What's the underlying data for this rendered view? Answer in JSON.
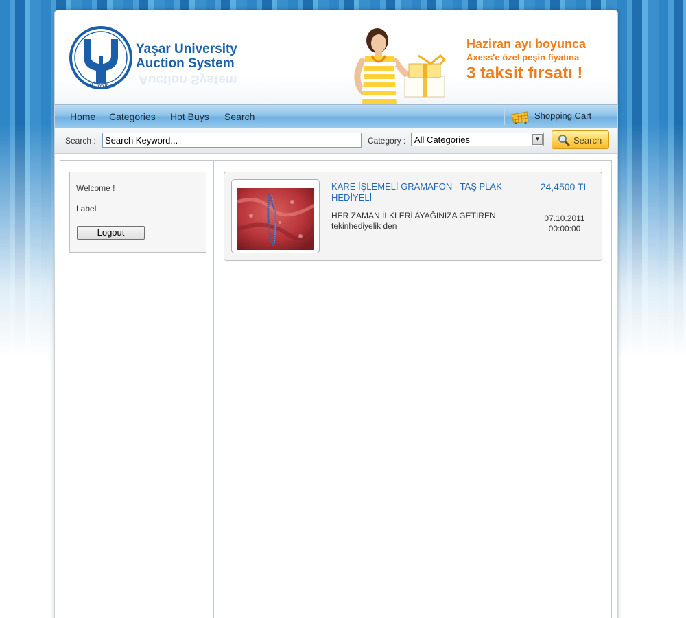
{
  "logo": {
    "line1": "Yaşar University",
    "line2": "Auction System",
    "year_prefix": "10",
    "year_sup": "th",
    "year_suffix": " year"
  },
  "promo": {
    "line1": "Haziran ayı boyunca",
    "line2": "Axess'e özel peşin fiyatına",
    "line3": "3 taksit fırsatı !"
  },
  "nav": {
    "items": [
      {
        "label": "Home"
      },
      {
        "label": "Categories"
      },
      {
        "label": "Hot Buys"
      },
      {
        "label": "Search"
      }
    ],
    "cart_label": "Shopping Cart"
  },
  "search": {
    "label": "Search :",
    "value": "Search Keyword...",
    "category_label": "Category :",
    "category_selected": "All Categories",
    "button_label": "Search"
  },
  "sidebar": {
    "welcome": "Welcome !",
    "label": "Label",
    "logout_label": "Logout"
  },
  "products": [
    {
      "title": "KARE İŞLEMELİ GRAMAFON - TAŞ PLAK HEDİYELİ",
      "description_line1": "HER ZAMAN İLKLERİ AYAĞINIZA GETİREN",
      "description_line2": "tekinhediyelik den",
      "price": "24,4500 TL",
      "date": "07.10.2011",
      "time": "00:00:00"
    }
  ],
  "colors": {
    "brand_blue": "#1a5fa8",
    "promo_orange": "#f07b1b",
    "link_blue": "#2168b3",
    "search_button": "#ffd65a"
  },
  "icons": {
    "cart": "shopping-cart-icon",
    "search": "magnifier-icon",
    "select": "chevron-down-icon"
  }
}
